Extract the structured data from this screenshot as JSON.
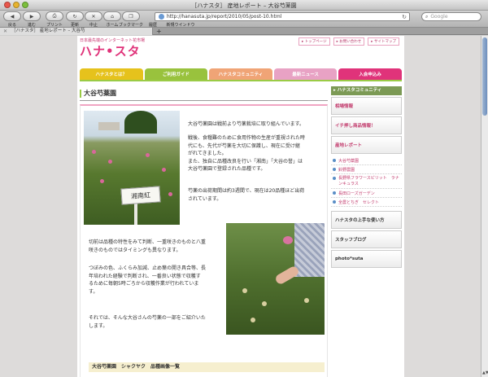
{
  "window": {
    "title": "［ハナスタ］ 産地レポート – 大谷芍薬園"
  },
  "toolbar": {
    "back": "戻る",
    "forward": "進む",
    "print": "プリント",
    "reload": "更新",
    "stop": "中止",
    "home": "ホーム",
    "bookmark": "ブックマーク",
    "history": "履歴",
    "new_window": "新規ウインドウ",
    "url": "http://hanasuta.jp/report/2010/05/post-10.html",
    "search_placeholder": "Google"
  },
  "tabs": [
    {
      "label": "［ハナスタ］ 産地レポート – 大谷芍"
    }
  ],
  "site": {
    "tagline": "日本最先端のインターネット花市場",
    "logo": "ハナ•スタ",
    "top_links": [
      "トップページ",
      "お問い合わせ",
      "サイトマップ"
    ]
  },
  "nav": [
    {
      "label": "ハナスタとは？",
      "color": "#e6c21c"
    },
    {
      "label": "ご利用ガイド",
      "color": "#99c23d"
    },
    {
      "label": "ハナスタコミュニティ",
      "color": "#f0a476"
    },
    {
      "label": "最新ニュース",
      "color": "#e8a2c4"
    },
    {
      "label": "入会申込み",
      "color": "#e0337a"
    }
  ],
  "main": {
    "heading": "大谷芍薬園",
    "sign_text": "湘南紅",
    "para1": "大谷芍薬園は戦前より芍薬栽培に取り組んでいます。",
    "para2": "戦後、食糧難のために食用作物の生産が重視された時\n代にも、先代が芍薬を大切に保護し、現在に受け継\nがれてきました。\nまた、独自に品種改良を行い「湘南」「大谷の誉」は\n大谷芍薬園で登録された品種です。",
    "para3": "芍薬の出荷期間は約3週間で、現在は20品種ほど出荷\nされています。",
    "para4": "切前は品種の特性をみて判断、一重咲きのものと八重\n咲きのものではタイミングも異なります。",
    "para5": "つぼみの色、ふくらみ加減、止め葉の開き具合等、長\n年培われた経験で判断され、一番良い状態で収穫す\nるために毎朝5時ごろから収穫作業が行われていま\nす。",
    "para6": "それでは、そんな大谷さんの芍薬の一部をご紹介いた\nします。",
    "para7": "大谷芍薬園　シャクヤク　品種画像一覧"
  },
  "sidebar": {
    "header": "ハナスタコミュニティ",
    "items_top": [
      "相場情報",
      "イチ押し商品情報！",
      "産地レポート"
    ],
    "report_links": [
      "大谷芍薬園",
      "鈴野農園",
      "長野県フラワースピリット　ラナンキュラス",
      "長田ローズガーデン",
      "全農とちぎ　セレクト"
    ],
    "items_bottom": [
      "ハナスタの上手な使い方",
      "スタッフブログ",
      "photo*suta"
    ]
  }
}
